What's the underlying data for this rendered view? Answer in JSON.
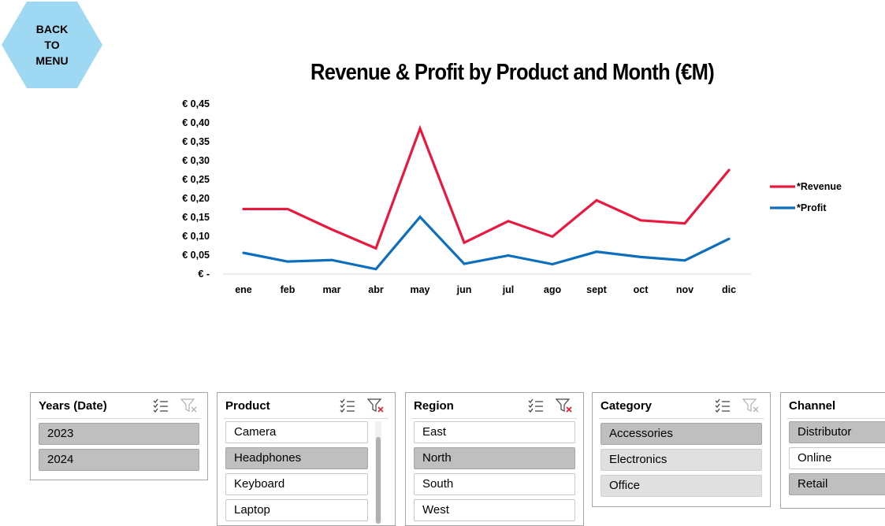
{
  "back_button": {
    "label": "BACK\nTO\nMENU"
  },
  "chart": {
    "title": "Revenue & Profit by Product and Month (€M)"
  },
  "chart_data": {
    "type": "line",
    "title": "Revenue & Profit by Product and Month (€M)",
    "categories": [
      "ene",
      "feb",
      "mar",
      "abr",
      "may",
      "jun",
      "jul",
      "ago",
      "sept",
      "oct",
      "nov",
      "dic"
    ],
    "y_tick_labels": [
      "€ -",
      "€ 0,05",
      "€ 0,10",
      "€ 0,15",
      "€ 0,20",
      "€ 0,25",
      "€ 0,30",
      "€ 0,35",
      "€ 0,40",
      "€ 0,45"
    ],
    "ylim": [
      0,
      0.45
    ],
    "grid": false,
    "legend_position": "right",
    "series": [
      {
        "name": "*Revenue",
        "color": "#e8193c",
        "values": [
          0.172,
          0.172,
          0.118,
          0.068,
          0.385,
          0.083,
          0.14,
          0.099,
          0.195,
          0.142,
          0.134,
          0.275
        ]
      },
      {
        "name": "*Profit",
        "color": "#0b6fbd",
        "values": [
          0.056,
          0.033,
          0.037,
          0.013,
          0.151,
          0.027,
          0.049,
          0.026,
          0.059,
          0.045,
          0.036,
          0.093
        ]
      }
    ]
  },
  "slicers": {
    "years": {
      "title": "Years (Date)",
      "items": [
        "2023",
        "2024"
      ]
    },
    "product": {
      "title": "Product",
      "items": [
        "Camera",
        "Headphones",
        "Keyboard",
        "Laptop"
      ]
    },
    "region": {
      "title": "Region",
      "items": [
        "East",
        "North",
        "South",
        "West"
      ]
    },
    "category": {
      "title": "Category",
      "items": [
        "Accessories",
        "Electronics",
        "Office"
      ]
    },
    "channel": {
      "title": "Channel",
      "items": [
        "Distributor",
        "Online",
        "Retail"
      ]
    }
  }
}
